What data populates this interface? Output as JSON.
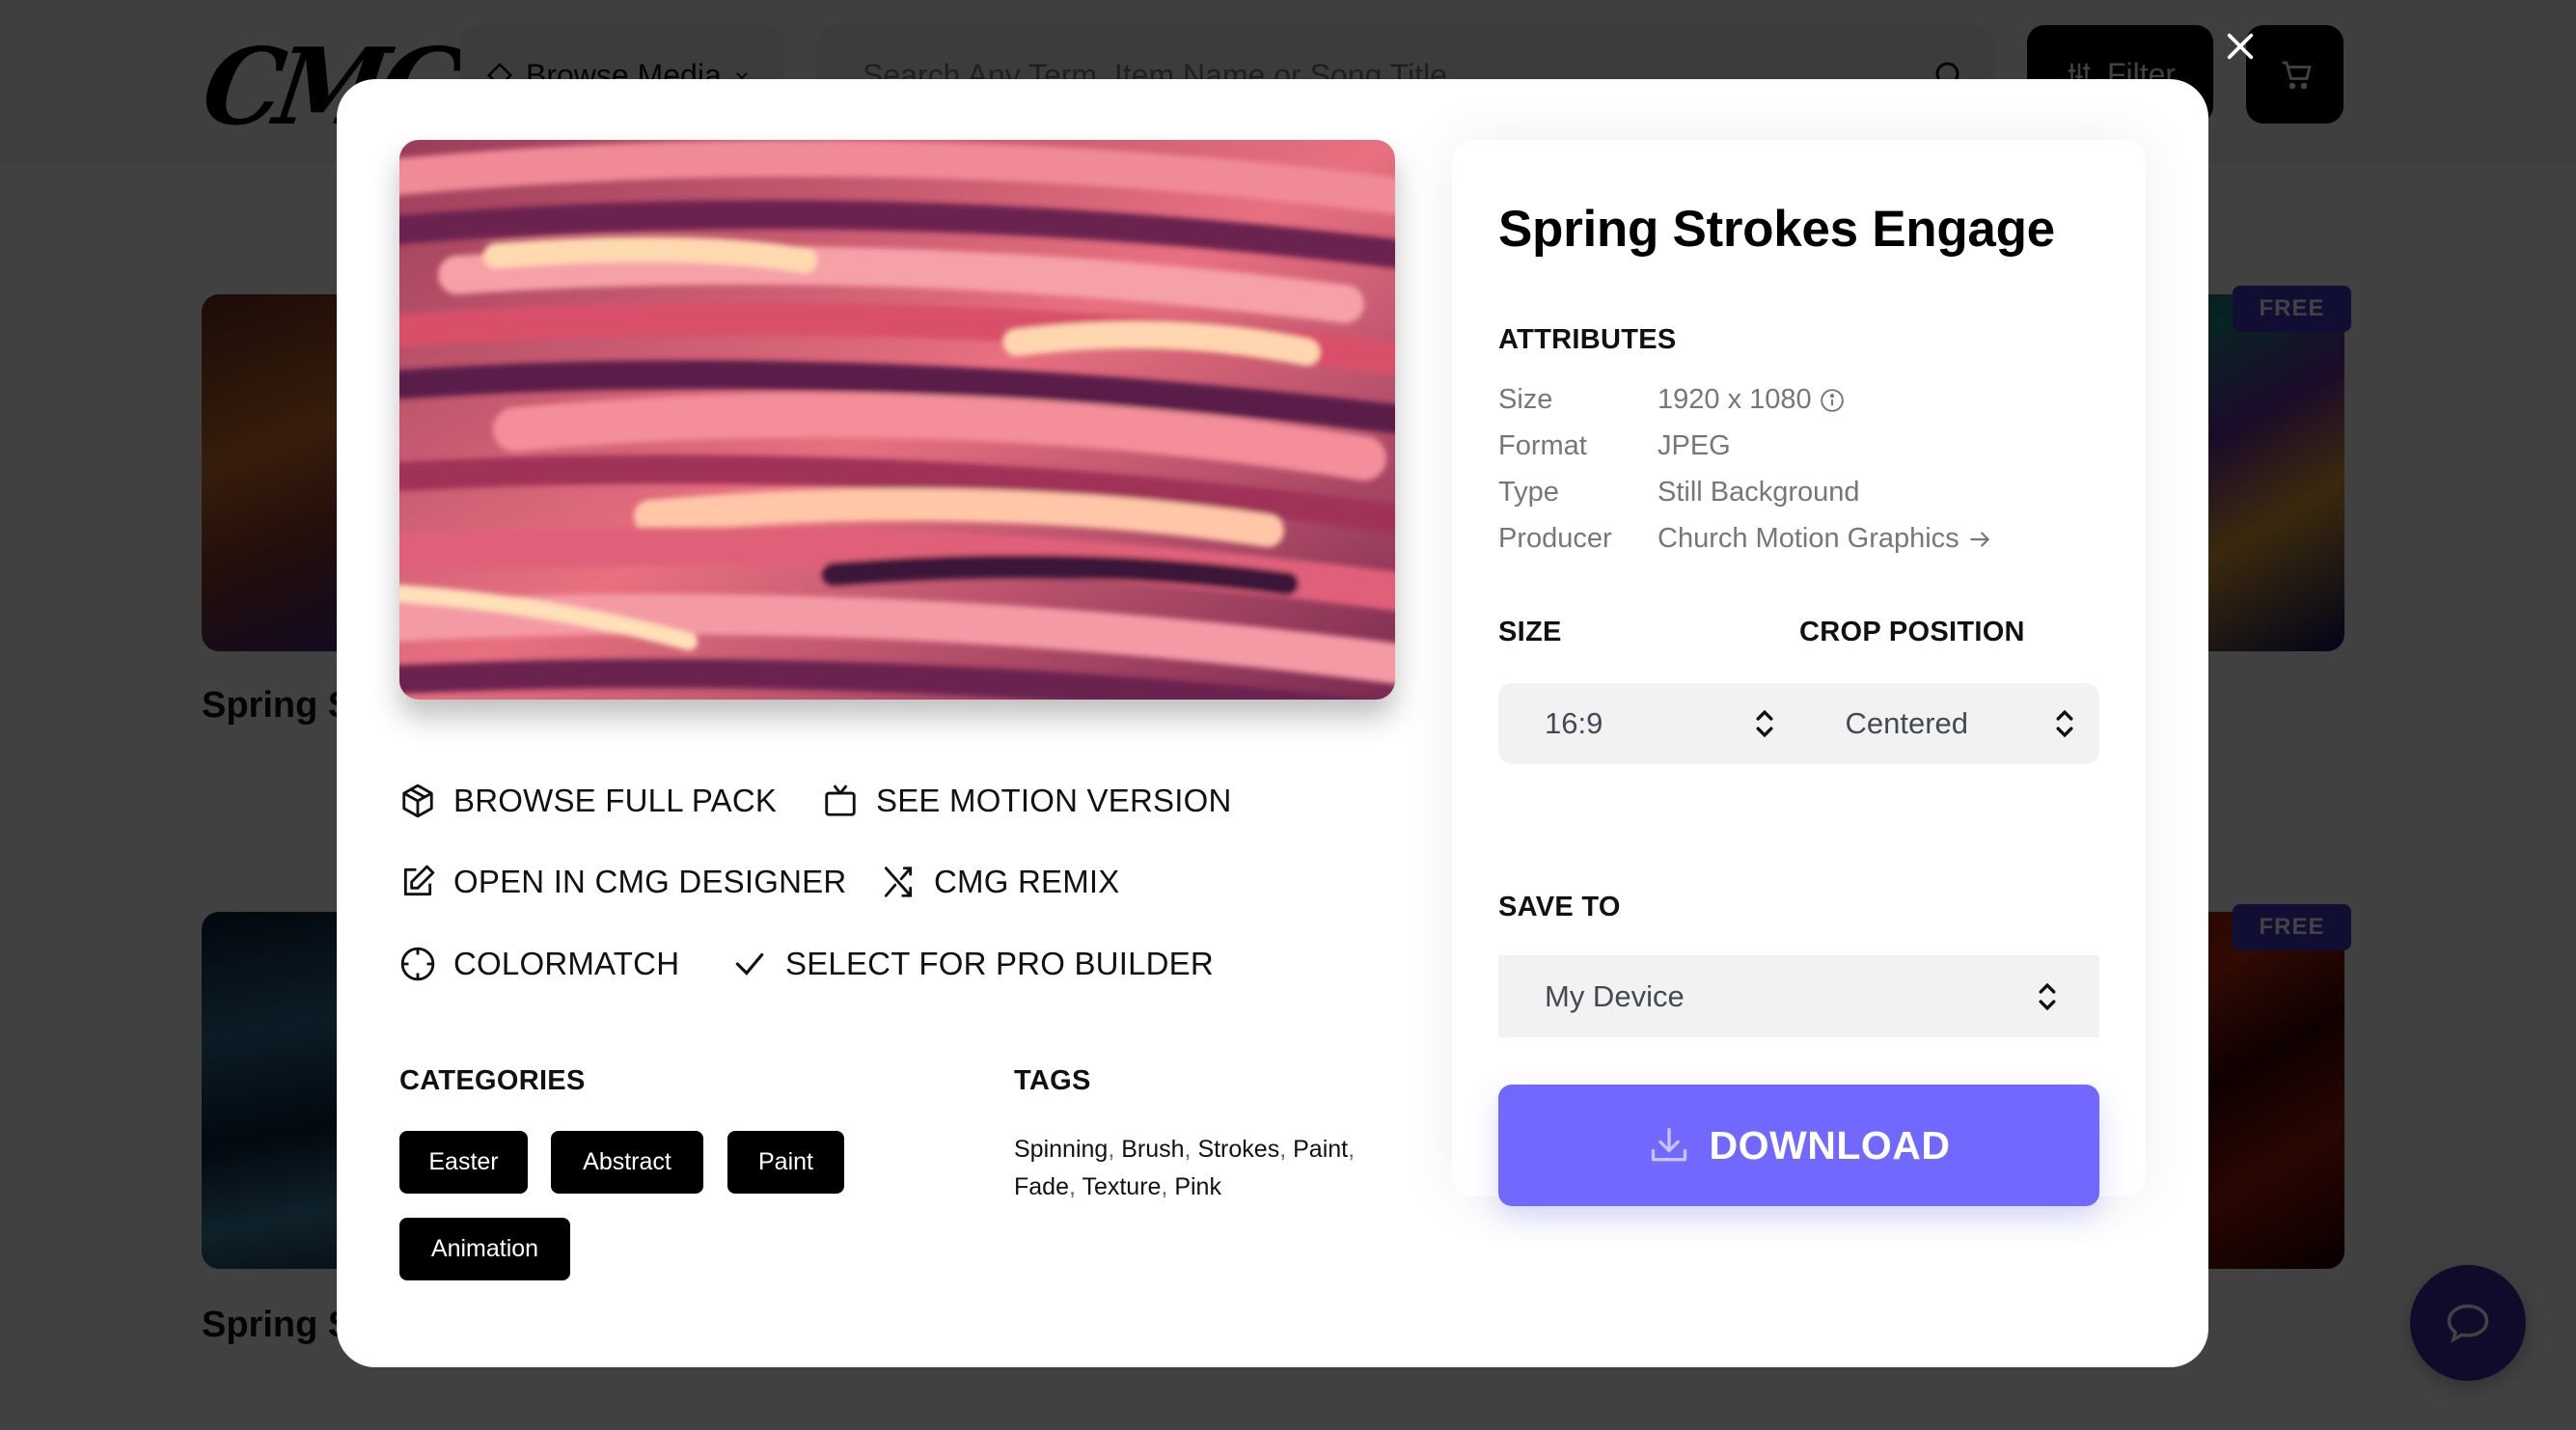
{
  "header": {
    "logo_text": "CMG",
    "browse_label": "Browse Media",
    "search_placeholder": "Search Any Term, Item Name or Song Title",
    "filter_label": "Filter"
  },
  "background": {
    "thumb_title_1": "Spring S",
    "thumb_title_2": "Spring S",
    "badge_1": "FREE",
    "badge_2": "FREE"
  },
  "modal": {
    "actions": [
      {
        "label": "BROWSE FULL PACK",
        "icon": "package-icon"
      },
      {
        "label": "SEE MOTION VERSION",
        "icon": "tv-icon"
      },
      {
        "label": "OPEN IN CMG DESIGNER",
        "icon": "edit-icon"
      },
      {
        "label": "CMG REMIX",
        "icon": "shuffle-icon"
      },
      {
        "label": "COLORMATCH",
        "icon": "crosshair-icon"
      },
      {
        "label": "SELECT FOR PRO BUILDER",
        "icon": "check-icon"
      }
    ],
    "categories_heading": "CATEGORIES",
    "categories": [
      "Easter",
      "Abstract",
      "Paint",
      "Animation"
    ],
    "tags_heading": "TAGS",
    "tags": [
      "Spinning",
      "Brush",
      "Strokes",
      "Paint",
      "Fade",
      "Texture",
      "Pink"
    ]
  },
  "panel": {
    "title": "Spring Strokes Engage",
    "attributes_heading": "ATTRIBUTES",
    "attributes": [
      {
        "key": "Size",
        "value": "1920 x 1080"
      },
      {
        "key": "Format",
        "value": "JPEG"
      },
      {
        "key": "Type",
        "value": "Still Background"
      },
      {
        "key": "Producer",
        "value": "Church Motion Graphics"
      }
    ],
    "size_heading": "SIZE",
    "crop_heading": "CROP POSITION",
    "size_value": "16:9",
    "crop_value": "Centered",
    "save_heading": "SAVE TO",
    "save_value": "My Device",
    "download_label": "DOWNLOAD"
  },
  "colors": {
    "accent": "#7068ff",
    "chip_bg": "#000000",
    "overlay": "rgba(0,0,0,0.74)"
  }
}
